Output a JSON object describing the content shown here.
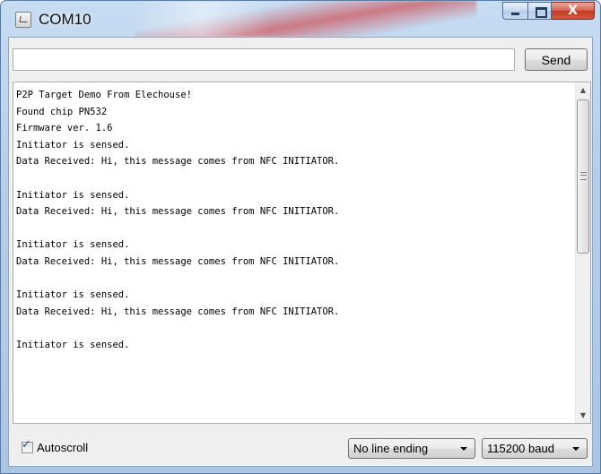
{
  "window": {
    "title": "COM10",
    "close_glyph": "X"
  },
  "send": {
    "input_value": "",
    "button_label": "Send"
  },
  "serial_output": {
    "lines": [
      "P2P Target Demo From Elechouse!",
      "Found chip PN532",
      "Firmware ver. 1.6",
      "Initiator is sensed.",
      "Data Received: Hi, this message comes from NFC INITIATOR.",
      "",
      "Initiator is sensed.",
      "Data Received: Hi, this message comes from NFC INITIATOR.",
      "",
      "Initiator is sensed.",
      "Data Received: Hi, this message comes from NFC INITIATOR.",
      "",
      "Initiator is sensed.",
      "Data Received: Hi, this message comes from NFC INITIATOR.",
      "",
      "Initiator is sensed."
    ]
  },
  "footer": {
    "autoscroll_label": "Autoscroll",
    "autoscroll_checked": true,
    "line_ending_selected": "No line ending",
    "baud_selected": "115200 baud"
  },
  "icons": {
    "app": "serial-monitor-icon",
    "minimize": "minimize-icon",
    "maximize": "maximize-icon",
    "close": "close-icon",
    "scroll_up": "scroll-up-arrow-icon",
    "scroll_down": "scroll-down-arrow-icon",
    "dropdown": "chevron-down-icon",
    "check": "checkmark-icon"
  },
  "colors": {
    "title_frame": "#b6cfe9",
    "close_button": "#c13a24",
    "client_background": "#efefef"
  }
}
